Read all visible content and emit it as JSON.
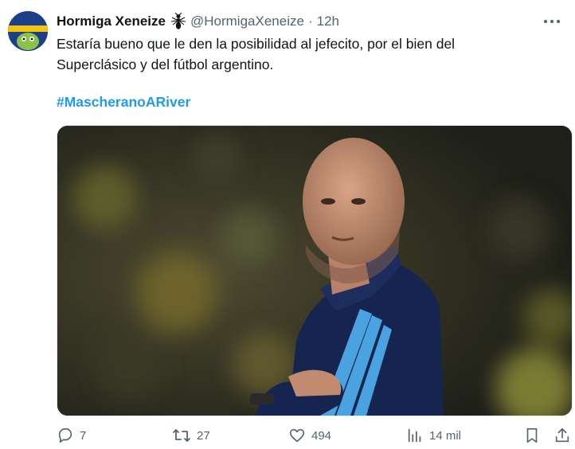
{
  "tweet": {
    "author_name": "Hormiga Xeneize",
    "handle": "@HormigaXeneize",
    "separator": "·",
    "time": "12h",
    "text_line1": "Estaría bueno que le den la posibilidad al jefecito, por el bien del",
    "text_line2": "Superclásico y del fútbol argentino.",
    "hashtag": "#MascheranoARiver"
  },
  "actions": {
    "replies": "7",
    "retweets": "27",
    "likes": "494",
    "views": "14 mil"
  },
  "icons": {
    "more": "more-icon",
    "badge": "ant-icon",
    "reply": "reply-icon",
    "retweet": "retweet-icon",
    "like": "heart-icon",
    "views": "views-icon",
    "bookmark": "bookmark-icon",
    "share": "share-icon"
  },
  "colors": {
    "text": "#0f1419",
    "secondary": "#536471",
    "link": "#1d9bf0"
  }
}
